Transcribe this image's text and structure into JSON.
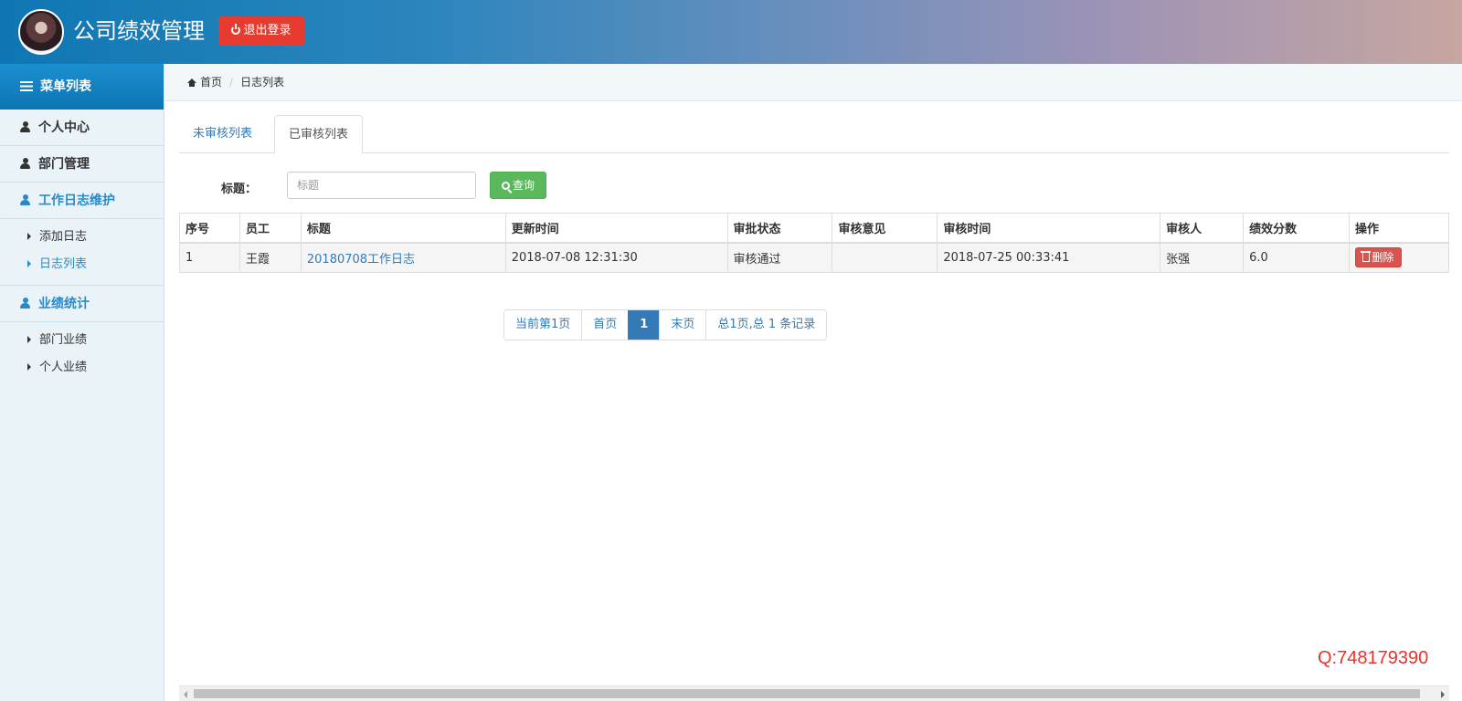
{
  "header": {
    "title": "公司绩效管理",
    "logout_label": "退出登录"
  },
  "sidebar": {
    "menu_title": "菜单列表",
    "items": [
      {
        "label": "个人中心"
      },
      {
        "label": "部门管理"
      },
      {
        "label": "工作日志维护",
        "children": [
          "添加日志",
          "日志列表"
        ]
      },
      {
        "label": "业绩统计",
        "children": [
          "部门业绩",
          "个人业绩"
        ]
      }
    ]
  },
  "breadcrumb": {
    "home": "首页",
    "current": "日志列表"
  },
  "tabs": [
    "未审核列表",
    "已审核列表"
  ],
  "search": {
    "label": "标题：",
    "placeholder": "标题",
    "button_label": "查询"
  },
  "table": {
    "columns": [
      "序号",
      "员工",
      "标题",
      "更新时间",
      "审批状态",
      "审核意见",
      "审核时间",
      "审核人",
      "绩效分数",
      "操作"
    ],
    "rows": [
      {
        "index": "1",
        "employee": "王霞",
        "title": "20180708工作日志",
        "updated": "2018-07-08 12:31:30",
        "status": "审核通过",
        "opinion": "",
        "review_time": "2018-07-25 00:33:41",
        "reviewer": "张强",
        "score": "6.0",
        "action": "删除"
      }
    ]
  },
  "pagination": {
    "current_text": "当前第1页",
    "first": "首页",
    "page": "1",
    "last": "末页",
    "summary": "总1页,总 1 条记录"
  },
  "watermark": "Q:748179390",
  "colors": {
    "accent": "#337ab7",
    "danger": "#d9534f",
    "success": "#5cb85c",
    "logout": "#e63b2e"
  }
}
